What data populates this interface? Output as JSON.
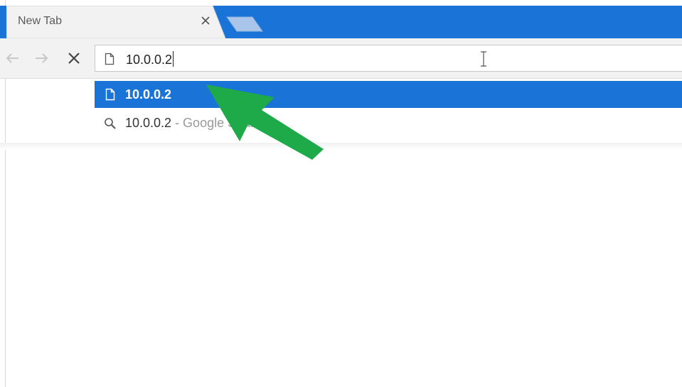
{
  "browser": {
    "tabs": [
      {
        "title": "New Tab",
        "close_icon": "close-icon"
      }
    ],
    "new_tab_icon": "new-tab-icon"
  },
  "toolbar": {
    "back_icon": "back-arrow-icon",
    "forward_icon": "forward-arrow-icon",
    "stop_icon": "stop-icon",
    "omnibox": {
      "value": "10.0.0.2",
      "page_icon": "page-icon"
    }
  },
  "suggestions": [
    {
      "text": "10.0.0.2",
      "icon": "page-icon",
      "selected": true
    },
    {
      "text": "10.0.0.2",
      "suffix": " - Google Search",
      "icon": "search-icon",
      "selected": false
    }
  ],
  "colors": {
    "accent": "#1a74d8",
    "annotation_arrow": "#1faa4a"
  }
}
